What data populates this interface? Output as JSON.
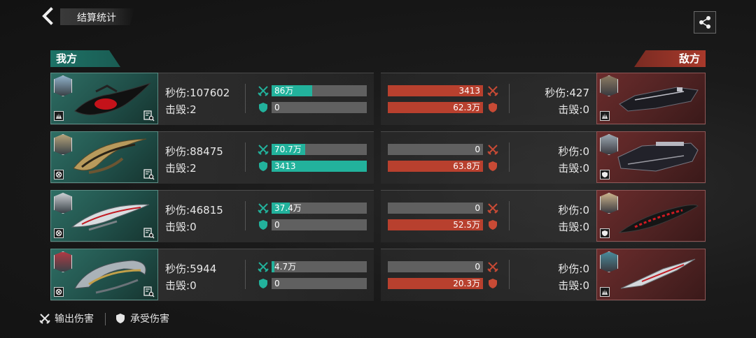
{
  "header": {
    "title": "结算统计",
    "back_icon": "chevron-left-icon",
    "share_icon": "share-icon"
  },
  "teams": {
    "ally_label": "我方",
    "enemy_label": "敌方",
    "ally_color": "#1d7266",
    "enemy_color": "#a8392b"
  },
  "labels": {
    "dps": "秒伤:",
    "kills": "击毁:"
  },
  "allies": [
    {
      "dps": "107602",
      "kills": "2",
      "damage_dealt": "86万",
      "damage_dealt_fraction": 0.43,
      "damage_taken": "0",
      "damage_taken_fraction": 0.0,
      "class_icon": "triple-spike-icon"
    },
    {
      "dps": "88475",
      "kills": "2",
      "damage_dealt": "70.7万",
      "damage_dealt_fraction": 0.35,
      "damage_taken": "3413",
      "damage_taken_fraction": 1.0,
      "class_icon": "crosshair-icon"
    },
    {
      "dps": "46815",
      "kills": "0",
      "damage_dealt": "37.4万",
      "damage_dealt_fraction": 0.19,
      "damage_taken": "0",
      "damage_taken_fraction": 0.0,
      "class_icon": "crosshair-icon"
    },
    {
      "dps": "5944",
      "kills": "0",
      "damage_dealt": "4.7万",
      "damage_dealt_fraction": 0.03,
      "damage_taken": "0",
      "damage_taken_fraction": 0.0,
      "class_icon": "crosshair-icon"
    }
  ],
  "enemies": [
    {
      "dps": "427",
      "kills": "0",
      "damage_dealt": "3413",
      "damage_dealt_fraction": 1.0,
      "damage_taken": "62.3万",
      "damage_taken_fraction": 1.0,
      "class_icon": "triple-spike-icon"
    },
    {
      "dps": "0",
      "kills": "0",
      "damage_dealt": "0",
      "damage_dealt_fraction": 0.0,
      "damage_taken": "63.8万",
      "damage_taken_fraction": 1.0,
      "class_icon": "shield-badge-icon"
    },
    {
      "dps": "0",
      "kills": "0",
      "damage_dealt": "0",
      "damage_dealt_fraction": 0.0,
      "damage_taken": "52.5万",
      "damage_taken_fraction": 1.0,
      "class_icon": "shield-badge-icon"
    },
    {
      "dps": "0",
      "kills": "0",
      "damage_dealt": "0",
      "damage_dealt_fraction": 0.0,
      "damage_taken": "20.3万",
      "damage_taken_fraction": 1.0,
      "class_icon": "triple-spike-icon"
    }
  ],
  "legend": {
    "dealt_label": "输出伤害",
    "taken_label": "承受伤害"
  }
}
